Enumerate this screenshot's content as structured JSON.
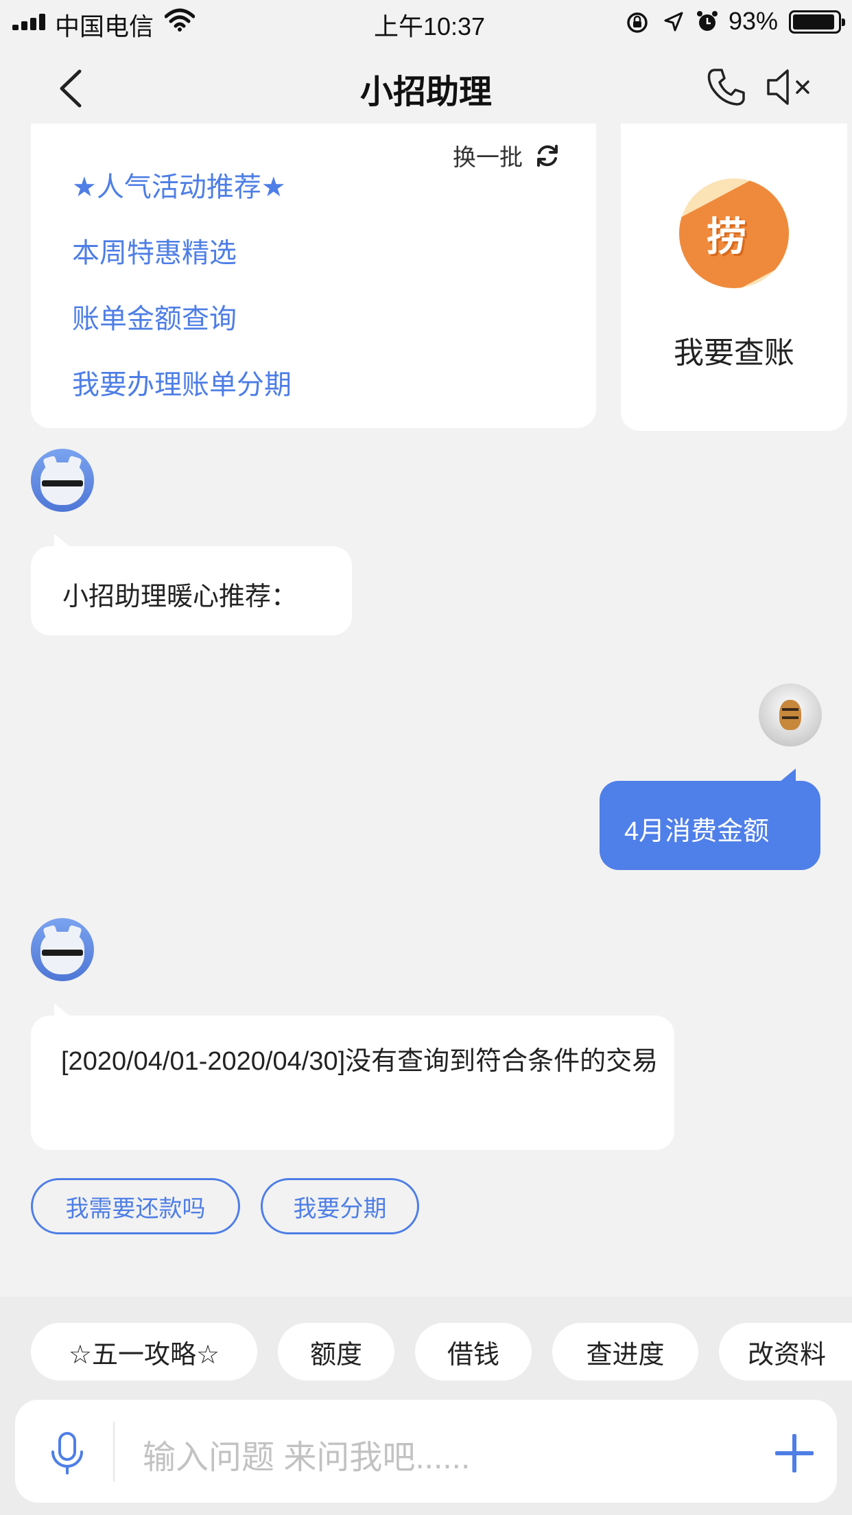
{
  "status_bar": {
    "carrier": "中国电信",
    "time": "上午10:37",
    "battery_percent": "93%",
    "battery_level": 0.93,
    "icons": [
      "signal-icon",
      "wifi-icon",
      "rotation-lock-icon",
      "location-icon",
      "alarm-icon",
      "battery-icon"
    ]
  },
  "nav": {
    "title": "小招助理",
    "icons": [
      "back-arrow-icon",
      "phone-icon",
      "speaker-mute-icon"
    ]
  },
  "menu_card": {
    "refresh_label": "换一批",
    "items": [
      "★人气活动推荐★",
      "本周特惠精选",
      "账单金额查询",
      "我要办理账单分期"
    ]
  },
  "side_card": {
    "icon_glyph": "捞",
    "label": "我要查账"
  },
  "messages": {
    "bot_1": "小招助理暖心推荐：",
    "user_1": "4月消费金额",
    "bot_2": "[2020/04/01-2020/04/30]没有查询到符合条件的交易"
  },
  "suggestions": [
    "我需要还款吗",
    "我要分期"
  ],
  "quick_actions": [
    "☆五一攻略☆",
    "额度",
    "借钱",
    "查进度",
    "改资料"
  ],
  "input": {
    "placeholder": "输入问题 来问我吧......"
  },
  "colors": {
    "accent": "#4e7ee6",
    "user_bubble": "#4f7fe8",
    "background": "#f2f2f2"
  }
}
